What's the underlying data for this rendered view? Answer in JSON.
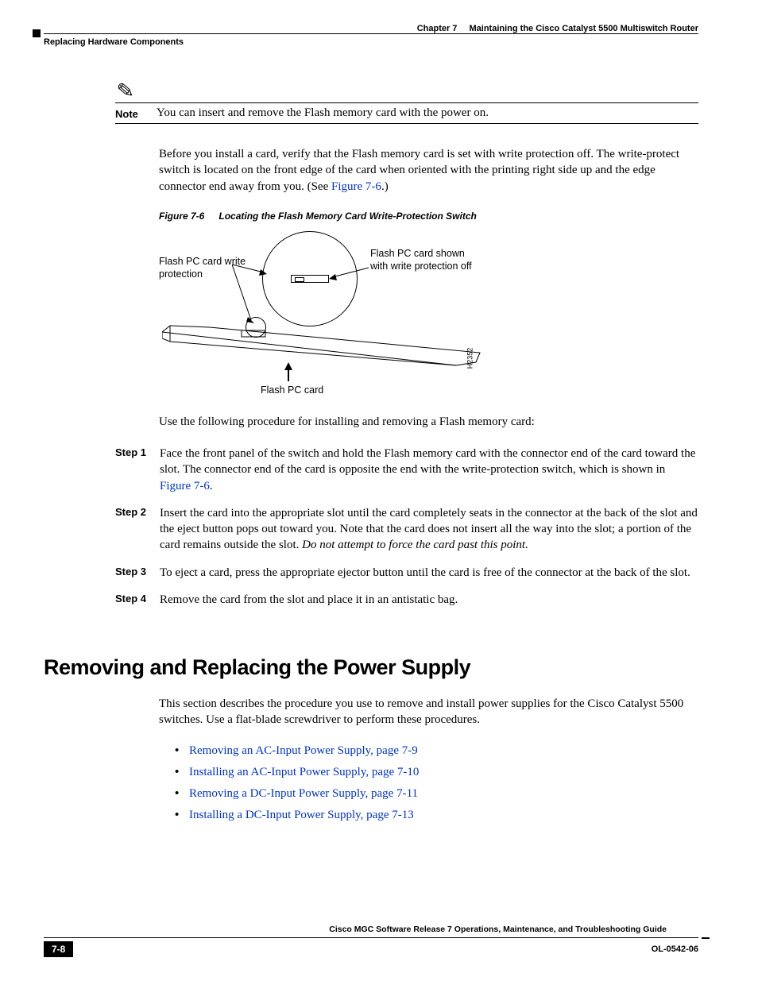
{
  "header": {
    "chapter_label": "Chapter 7",
    "chapter_title": "Maintaining the Cisco Catalyst 5500 Multiswitch Router",
    "section_title": "Replacing Hardware Components"
  },
  "note": {
    "label": "Note",
    "text": "You can insert and remove the Flash memory card with the power on."
  },
  "para1_a": "Before you install a card, verify that the Flash memory card is set with write protection off. The write-protect switch is located on the front edge of the card when oriented with the printing right side up and the edge connector end away from you. (See ",
  "para1_link": "Figure 7-6",
  "para1_b": ".)",
  "figure": {
    "num": "Figure 7-6",
    "title": "Locating the Flash Memory Card Write-Protection Switch",
    "label_left": "Flash PC card write protection",
    "label_right": "Flash PC card shown with write protection off",
    "label_bottom": "Flash PC card",
    "code": "H2352"
  },
  "para2": "Use the following procedure for installing and removing a Flash memory card:",
  "steps": [
    {
      "label": "Step 1",
      "text_a": "Face the front panel of the switch and hold the Flash memory card with the connector end of the card toward the slot. The connector end of the card is opposite the end with the write-protection switch, which is shown in ",
      "link": "Figure 7-6",
      "text_b": "."
    },
    {
      "label": "Step 2",
      "text_a": "Insert the card into the appropriate slot until the card completely seats in the connector at the back of the slot and the eject button pops out toward you. Note that the card does not insert all the way into the slot; a portion of the card remains outside the slot. ",
      "italic": "Do not attempt to force the card past this point."
    },
    {
      "label": "Step 3",
      "text_a": "To eject a card, press the appropriate ejector button until the card is free of the connector at the back of the slot."
    },
    {
      "label": "Step 4",
      "text_a": "Remove the card from the slot and place it in an antistatic bag."
    }
  ],
  "section_heading": "Removing and Replacing the Power Supply",
  "para3": "This section describes the procedure you use to remove and install power supplies for the Cisco Catalyst 5500 switches. Use a flat-blade screwdriver to perform these procedures.",
  "links": [
    "Removing an AC-Input Power Supply, page 7-9",
    "Installing an AC-Input Power Supply, page 7-10",
    "Removing a DC-Input Power Supply, page 7-11",
    "Installing a DC-Input Power Supply, page 7-13"
  ],
  "footer": {
    "doc_title": "Cisco MGC Software Release 7 Operations, Maintenance, and Troubleshooting Guide",
    "page_num": "7-8",
    "doc_id": "OL-0542-06"
  }
}
